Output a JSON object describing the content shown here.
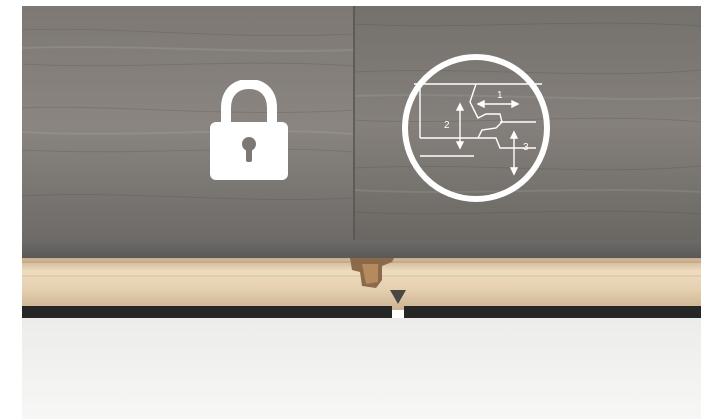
{
  "overlay": {
    "lock_icon": "lock-icon",
    "diagram_icon": "click-lock-profile-diagram",
    "labels": {
      "one": "1",
      "two": "2",
      "three": "3"
    }
  },
  "colors": {
    "icon": "#ffffff",
    "plank_surface": "#7a7672",
    "core_light": "#e6d2b4",
    "core_shadow": "#c3a886",
    "underlay": "#262626",
    "floor_base": "#eeeeec"
  }
}
